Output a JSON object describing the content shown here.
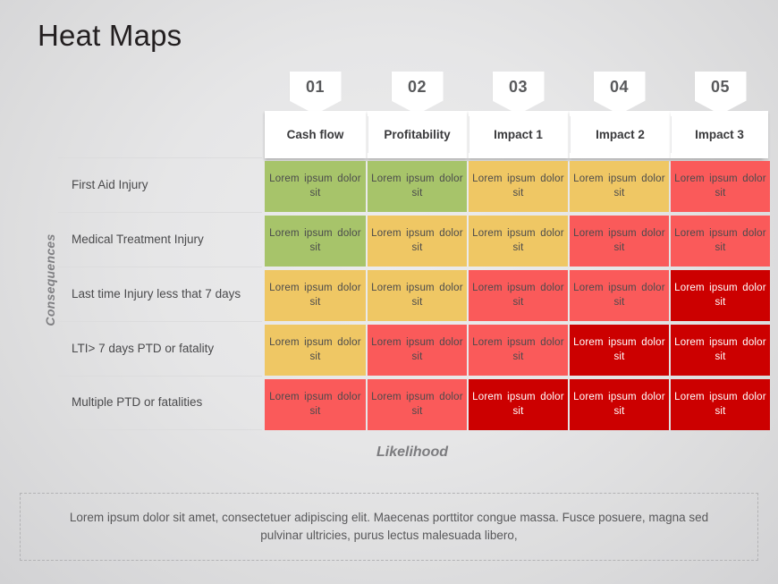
{
  "slide": {
    "title": "Heat Maps",
    "axis_y_label": "Consequences",
    "axis_x_label": "Likelihood",
    "caption": "Lorem ipsum dolor sit amet, consectetuer adipiscing elit. Maecenas porttitor congue massa. Fusce posuere, magna sed pulvinar ultricies, purus lectus malesuada libero,"
  },
  "columns": [
    {
      "number": "01",
      "label": "Cash flow"
    },
    {
      "number": "02",
      "label": "Profitability"
    },
    {
      "number": "03",
      "label": "Impact 1"
    },
    {
      "number": "04",
      "label": "Impact 2"
    },
    {
      "number": "05",
      "label": "Impact 3"
    }
  ],
  "rows": [
    {
      "label": "First Aid Injury"
    },
    {
      "label": "Medical Treatment Injury"
    },
    {
      "label": "Last time Injury  less that 7 days"
    },
    {
      "label": "LTI> 7 days PTD or fatality"
    },
    {
      "label": "Multiple PTD or fatalities"
    }
  ],
  "cell_text": "Lorem ipsum dolor sit",
  "palette": {
    "green": "#a7c46a",
    "amber": "#efc764",
    "red": "#fa5a5a",
    "dark_red": "#cc0000"
  },
  "chart_data": {
    "type": "heatmap",
    "title": "Heat Maps",
    "xlabel": "Likelihood",
    "ylabel": "Consequences",
    "x_categories": [
      "Cash flow",
      "Profitability",
      "Impact 1",
      "Impact 2",
      "Impact 3"
    ],
    "x_numbers": [
      "01",
      "02",
      "03",
      "04",
      "05"
    ],
    "y_categories": [
      "First Aid Injury",
      "Medical Treatment Injury",
      "Last time Injury  less that 7 days",
      "LTI> 7 days PTD or fatality",
      "Multiple PTD or fatalities"
    ],
    "levels": [
      "green",
      "amber",
      "red",
      "dark_red"
    ],
    "level_colors": {
      "green": "#a7c46a",
      "amber": "#efc764",
      "red": "#fa5a5a",
      "dark_red": "#cc0000"
    },
    "cell_label": "Lorem ipsum dolor sit",
    "values": [
      [
        "green",
        "green",
        "amber",
        "amber",
        "red"
      ],
      [
        "green",
        "amber",
        "amber",
        "red",
        "red"
      ],
      [
        "amber",
        "amber",
        "red",
        "red",
        "dark_red"
      ],
      [
        "amber",
        "red",
        "red",
        "dark_red",
        "dark_red"
      ],
      [
        "red",
        "red",
        "dark_red",
        "dark_red",
        "dark_red"
      ]
    ]
  }
}
